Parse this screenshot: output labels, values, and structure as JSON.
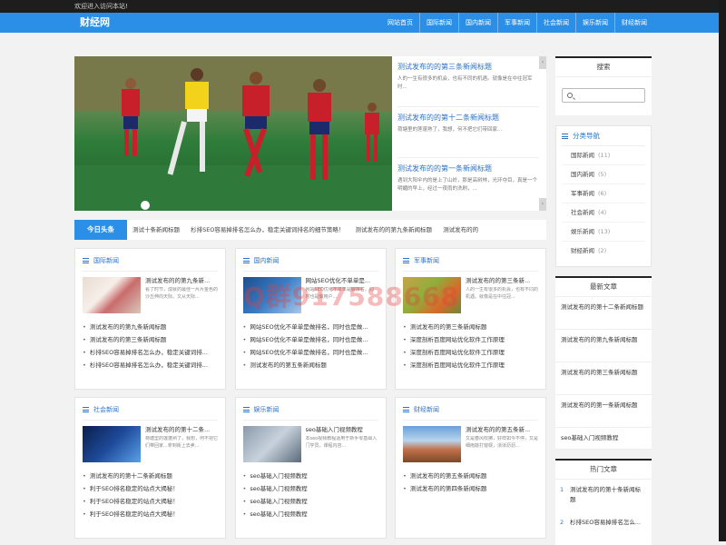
{
  "top": {
    "welcome": "欢迎进入访问本站!"
  },
  "nav": {
    "logo": "财经网",
    "links": [
      "网站首页",
      "国际新闻",
      "国内新闻",
      "军事新闻",
      "社会新闻",
      "娱乐新闻",
      "财经新闻"
    ]
  },
  "hero": {
    "items": [
      {
        "title": "测试发布的的第三条新闻标题",
        "desc": "人的一生有很多的机会，也有不同的机遇。就像是在中往冠军时..."
      },
      {
        "title": "测试发布的的第十二条新闻标题",
        "desc": "荷塘里的莲蓬熟了，我想，何不把它们带回家... "
      },
      {
        "title": "测试发布的的第一条新闻标题",
        "desc": "遇到大阳伞内的是上了山岭，那是高树林，光环夺目，真是一个明媚的早上，经过一夜雨的洗刷，..."
      }
    ],
    "prev": "‹",
    "next": "›"
  },
  "ticker": {
    "label": "今日头条",
    "items": [
      "测试十条新闻标题",
      "杉排SEO容易掉排名怎么办，稳定关键词排名的细节策略！",
      "测试发布的的第九条新闻标题",
      "测试发布的的"
    ]
  },
  "cards_row1": [
    {
      "title": "国际新闻",
      "feat_title": "测试发布的的第九条新...",
      "feat_desc": "看了时节，成就的最佳一片片金色的沙丘伸向天际。又从天际...",
      "links": [
        "测试发布的的第九条新闻标题",
        "测试发布的的第三条新闻标题",
        "杉排SEO容易掉排名怎么办，稳定关键词排...",
        "杉排SEO容易掉排名怎么办，稳定关键词排..."
      ]
    },
    {
      "title": "国内新闻",
      "feat_title": "网站SEO优化不单单是...",
      "feat_desc": "网站SEO优化不单单是做排名，同时也是做用户...",
      "links": [
        "网站SEO优化不单单是做排名，同时也是做...",
        "网站SEO优化不单单是做排名，同时也是做...",
        "网站SEO优化不单单是做排名，同时也是做...",
        "测试发布的的第五条新闻标题"
      ]
    },
    {
      "title": "军事新闻",
      "feat_title": "测试发布的的第三条新...",
      "feat_desc": "人的一生有很多的机会，也有不同的机遇。就像是在中往冠...",
      "links": [
        "测试发布的的第三条新闻标题",
        "深度剖析百度网站优化软件工作原理",
        "深度剖析百度网站优化软件工作原理",
        "深度剖析百度网站优化软件工作原理"
      ]
    }
  ],
  "cards_row2": [
    {
      "title": "社会新闻",
      "feat_title": "测试发布的的第十二条...",
      "feat_desc": "荷塘里的莲蓬熟了，我想，何不把它们带回家...拿到街上去卖...",
      "links": [
        "测试发布的的第十二条新闻标题",
        "利于SEO排名稳定的站点大揭秘！",
        "利于SEO排名稳定的站点大揭秘！",
        "利于SEO排名稳定的站点大揭秘！"
      ]
    },
    {
      "title": "娱乐新闻",
      "feat_title": "seo基础入门视频教程",
      "feat_desc": "本seo视频教程适用于新手零基础入门学员，课程内容...",
      "links": [
        "seo基础入门视频教程",
        "seo基础入门视频教程",
        "seo基础入门视频教程",
        "seo基础入门视频教程"
      ]
    },
    {
      "title": "财经新闻",
      "feat_title": "测试发布的的第五条新...",
      "feat_desc": "又是春风吹拂，好样如今不停，又是细雨敲打窗棂，淅淅沥沥...",
      "links": [
        "测试发布的的第五条新闻标题",
        "测试发布的的第四条新闻标题"
      ]
    }
  ],
  "sidebar": {
    "search_title": "搜索",
    "search_placeholder": "",
    "cat_title": "分类导航",
    "categories": [
      {
        "name": "国际新闻",
        "count": "(11)"
      },
      {
        "name": "国内新闻",
        "count": "(5)"
      },
      {
        "name": "军事新闻",
        "count": "(6)"
      },
      {
        "name": "社会新闻",
        "count": "(4)"
      },
      {
        "name": "娱乐新闻",
        "count": "(13)"
      },
      {
        "name": "财经新闻",
        "count": "(2)"
      }
    ],
    "latest_title": "最新文章",
    "latest": [
      "测试发布的的第十二条新闻标题",
      "测试发布的的第九条新闻标题",
      "测试发布的的第三条新闻标题",
      "测试发布的的第一条新闻标题",
      "seo基础入门视频教程"
    ],
    "hot_title": "热门文章",
    "hot": [
      {
        "num": "1",
        "title": "测试发布的的第十条新闻标题"
      },
      {
        "num": "2",
        "title": "杉排SEO容易掉排名怎么..."
      }
    ]
  },
  "watermark": "Q群917588668",
  "colors": {
    "accent": "#2b8fe8",
    "link": "#2b72c8"
  }
}
